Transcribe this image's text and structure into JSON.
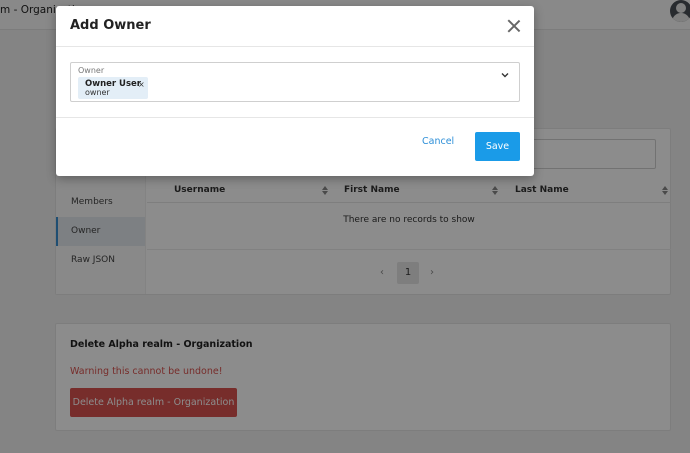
{
  "header": {
    "title": "m - Organizati",
    "avatar_icon": "user-avatar-icon"
  },
  "members_card": {
    "sidebar": [
      {
        "label": "Members",
        "active": false
      },
      {
        "label": "Owner",
        "active": true
      },
      {
        "label": "Raw JSON",
        "active": false
      }
    ],
    "columns": [
      "Username",
      "First Name",
      "Last Name"
    ],
    "empty_text": "There are no records to show",
    "pagination": {
      "prev": "‹",
      "current": "1",
      "next": "›"
    }
  },
  "delete_card": {
    "heading": "Delete Alpha realm - Organization",
    "warning": "Warning this cannot be undone!",
    "button_label": "Delete Alpha realm - Organization",
    "button_color": "#d9534f"
  },
  "modal": {
    "title": "Add Owner",
    "field_label": "Owner",
    "chip": {
      "name": "Owner User",
      "sub": "owner",
      "remove": "×"
    },
    "cancel_label": "Cancel",
    "save_label": "Save",
    "accent": "#1a9be8"
  }
}
